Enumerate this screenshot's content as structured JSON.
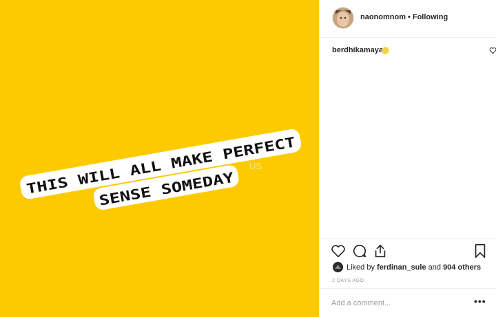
{
  "post": {
    "image": {
      "line1": "THIS WILL ALL MAKE PERFECT",
      "line2": "SENSE SOMEDAY",
      "watermark": "US",
      "background_color": "#fdca00"
    },
    "header": {
      "username": "naonomnom",
      "separator": "•",
      "follow_state": "Following"
    },
    "caption": {
      "username": "berdhikamaya",
      "emoji": "sun-emoji"
    },
    "likes": {
      "prefix": "Liked by",
      "user": "ferdinan_sule",
      "joiner": "and",
      "others": "904 others"
    },
    "timestamp": "2 DAYS AGO",
    "comment": {
      "placeholder": "Add a comment...",
      "more": "•••"
    },
    "icons": [
      "heart-icon",
      "comment-icon",
      "share-icon",
      "bookmark-icon",
      "more-options-icon"
    ],
    "colors": {
      "text": "#262626",
      "muted": "#999999",
      "border": "#efefef"
    }
  }
}
